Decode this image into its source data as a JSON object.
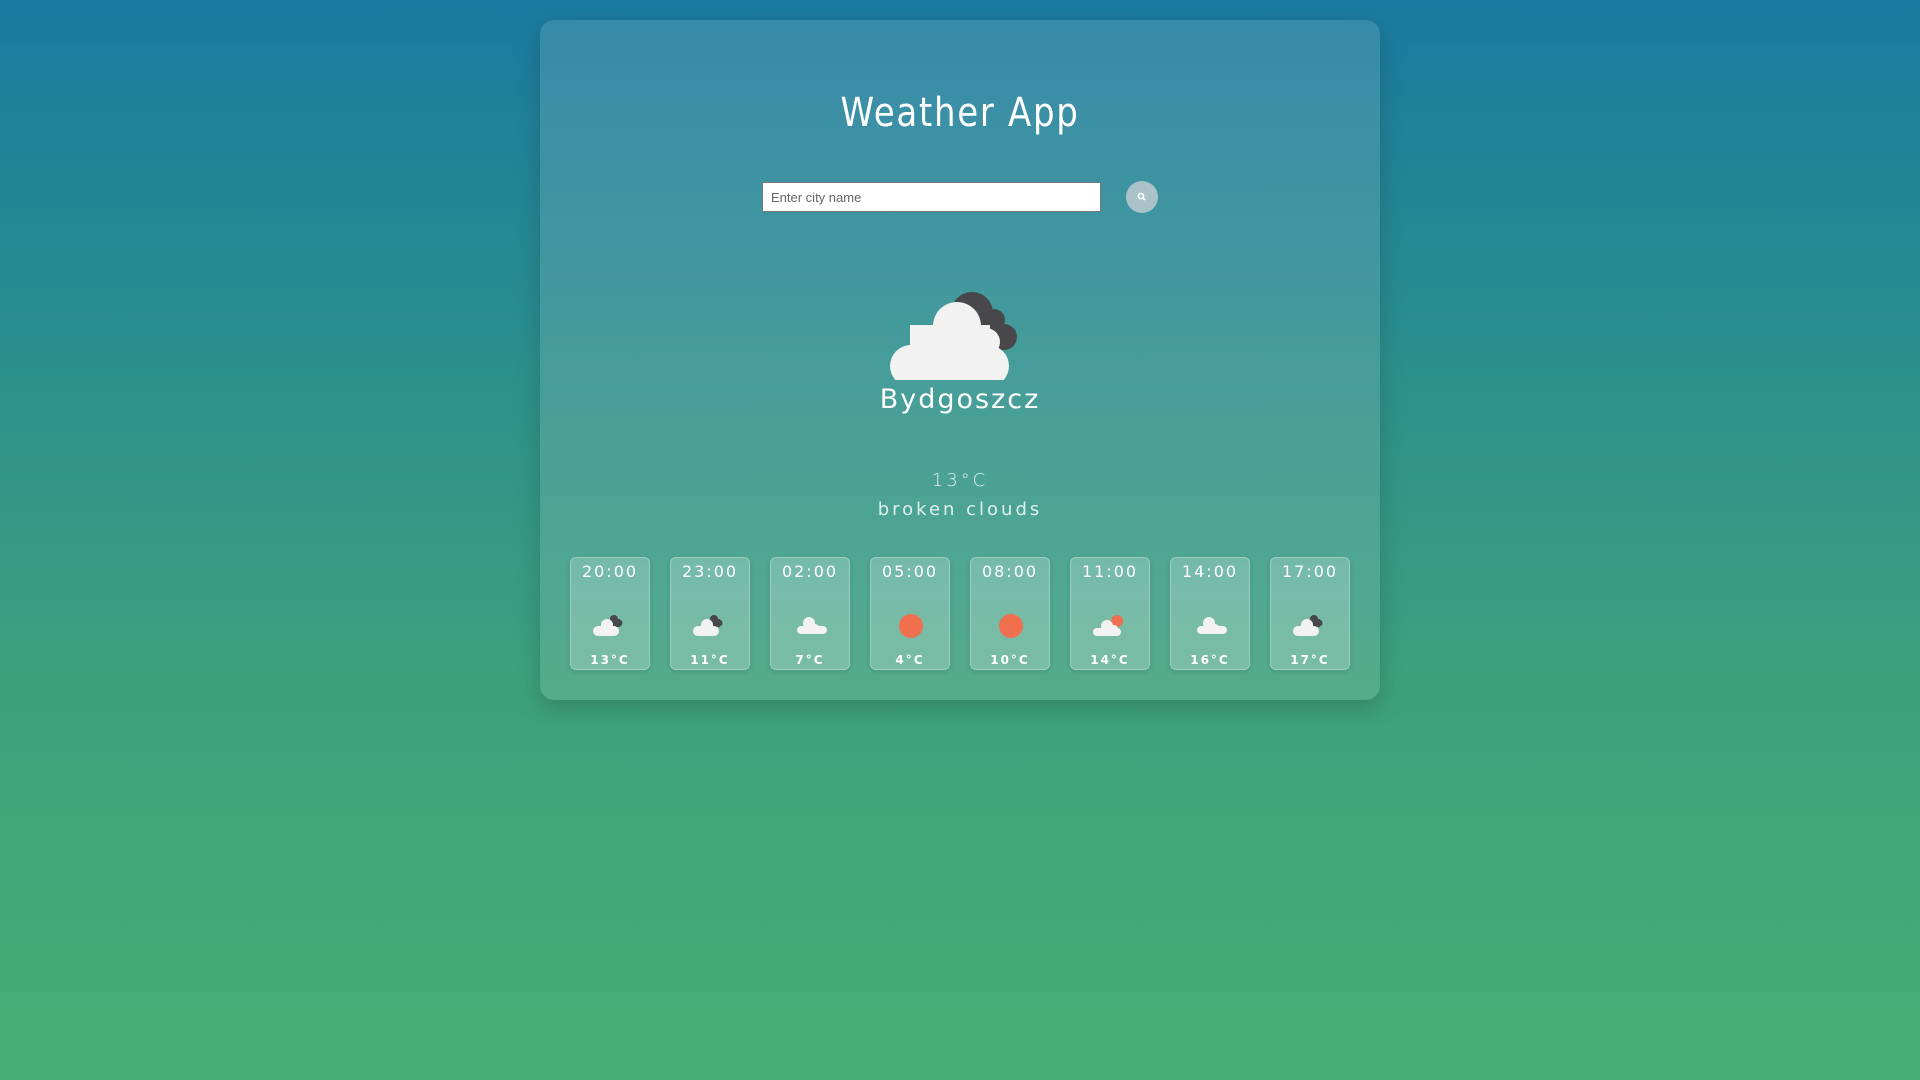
{
  "header": {
    "title": "Weather App"
  },
  "search": {
    "placeholder": "Enter city name",
    "value": ""
  },
  "current": {
    "icon": "broken-clouds-icon",
    "city": "Bydgoszcz",
    "temp": "13°C",
    "description": "broken clouds"
  },
  "forecast": [
    {
      "time": "20:00",
      "icon": "broken-clouds",
      "temp": "13°C"
    },
    {
      "time": "23:00",
      "icon": "broken-clouds",
      "temp": "11°C"
    },
    {
      "time": "02:00",
      "icon": "scattered-clouds",
      "temp": "7°C"
    },
    {
      "time": "05:00",
      "icon": "clear-sun",
      "temp": "4°C"
    },
    {
      "time": "08:00",
      "icon": "clear-sun",
      "temp": "10°C"
    },
    {
      "time": "11:00",
      "icon": "few-clouds",
      "temp": "14°C"
    },
    {
      "time": "14:00",
      "icon": "scattered-clouds",
      "temp": "16°C"
    },
    {
      "time": "17:00",
      "icon": "broken-clouds",
      "temp": "17°C"
    }
  ],
  "colors": {
    "sun": "#ef6f4f",
    "cloud": "#f2f2f2",
    "dark_cloud": "#48484a"
  }
}
